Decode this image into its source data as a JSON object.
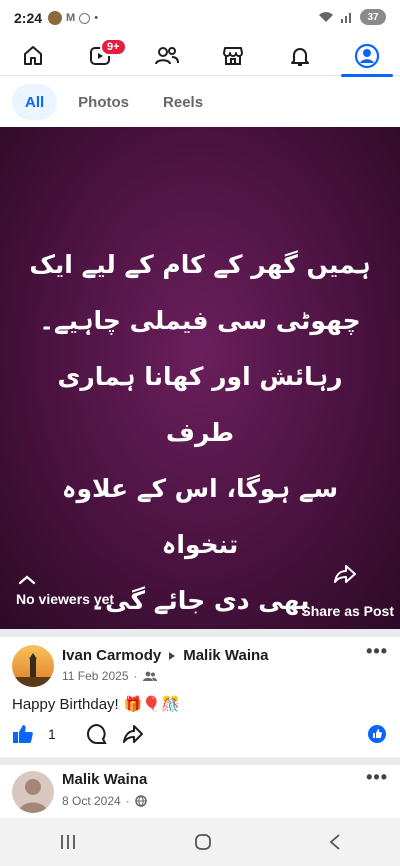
{
  "status_bar": {
    "time": "2:24",
    "battery": "37"
  },
  "nav": {
    "notifications_badge": "9+"
  },
  "tabs": [
    {
      "label": "All",
      "active": true
    },
    {
      "label": "Photos",
      "active": false
    },
    {
      "label": "Reels",
      "active": false
    }
  ],
  "story": {
    "text_lines": [
      "ہمیں گھر کے کام کے لیے ایک",
      "چھوٹی سی فیملی چاہیے۔",
      "رہائش اور کھانا ہماری طرف",
      "سے ہوگا، اس کے علاوہ تنخواہ",
      "بھی دی جائے گی۔"
    ],
    "viewers": "No viewers yet",
    "share_label": "Share as Post",
    "background_color": "#4a1240"
  },
  "post1": {
    "author": "Ivan Carmody",
    "target": "Malik Waina",
    "date": "11 Feb 2025",
    "text": "Happy Birthday!",
    "emoji": "🎁🎈🎊",
    "like_count": "1"
  },
  "post2": {
    "author": "Malik Waina",
    "date": "8 Oct 2024"
  },
  "colors": {
    "accent": "#0866ff",
    "badge": "#e41e3f"
  }
}
